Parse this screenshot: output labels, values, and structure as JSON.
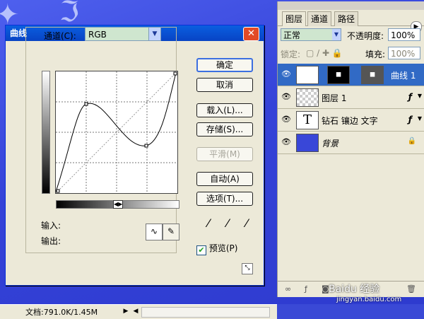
{
  "dialog": {
    "title": "曲线",
    "channel_label": "通道(C):",
    "channel_value": "RGB",
    "input_label": "输入:",
    "output_label": "输出:",
    "buttons": {
      "ok": "确定",
      "cancel": "取消",
      "load": "载入(L)...",
      "save": "存储(S)...",
      "smooth": "平滑(M)",
      "auto": "自动(A)",
      "options": "选项(T)..."
    },
    "preview_label": "预览(P)",
    "preview_checked": true
  },
  "layers_panel": {
    "tabs": [
      "图层",
      "通道",
      "路径"
    ],
    "blend_mode": "正常",
    "opacity_label": "不透明度:",
    "opacity_value": "100%",
    "lock_label": "锁定:",
    "fill_label": "填充:",
    "fill_value": "100%",
    "layers": [
      {
        "name": "曲线 1",
        "selected": true
      },
      {
        "name": "图层 1",
        "selected": false
      },
      {
        "name": "钻石 镶边 文字",
        "selected": false
      },
      {
        "name": "背景",
        "selected": false
      }
    ]
  },
  "status_bar": {
    "doc_info": "文档:791.0K/1.45M"
  },
  "watermark": {
    "text": "Baidu 经验",
    "url": "jingyan.baidu.com"
  }
}
